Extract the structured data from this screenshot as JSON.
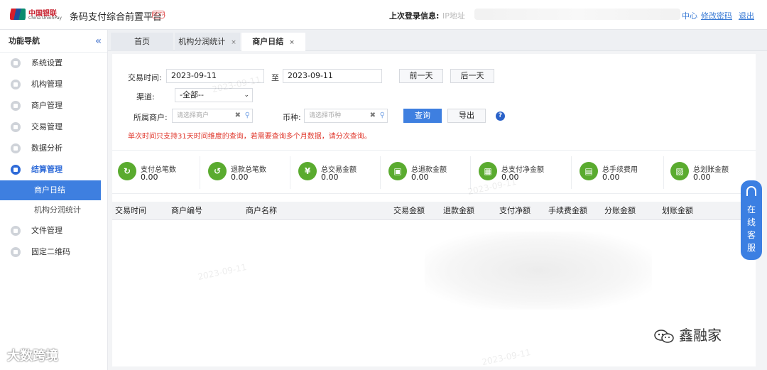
{
  "header": {
    "logo_cn": "中国银联",
    "logo_en": "China UnionPay",
    "app_title": "条码支付综合前置平台",
    "app_badge": "BETA",
    "login_info_label": "上次登录信息:",
    "login_ip_label": "IP地址",
    "personal_center": "中心",
    "change_password": "修改密码",
    "logout": "退出"
  },
  "sidebar": {
    "title": "功能导航",
    "collapse_icon": "«",
    "items": [
      {
        "label": "系统设置"
      },
      {
        "label": "机构管理"
      },
      {
        "label": "商户管理"
      },
      {
        "label": "交易管理"
      },
      {
        "label": "数据分析"
      },
      {
        "label": "结算管理"
      },
      {
        "label": "文件管理"
      },
      {
        "label": "固定二维码"
      }
    ],
    "sub_items": [
      {
        "label": "商户日结"
      },
      {
        "label": "机构分润统计"
      }
    ]
  },
  "tabs": [
    {
      "label": "首页"
    },
    {
      "label": "机构分润统计",
      "close": "×"
    },
    {
      "label": "商户日结",
      "close": "×"
    }
  ],
  "filters": {
    "date_label": "交易时间:",
    "date_from": "2023-09-11",
    "date_sep": "至",
    "date_to": "2023-09-11",
    "prev_day": "前一天",
    "next_day": "后一天",
    "channel_label": "渠道:",
    "channel_value": "-全部--",
    "merchant_label": "所属商户:",
    "merchant_placeholder": "请选择商户",
    "currency_label": "币种:",
    "currency_placeholder": "请选择币种",
    "query": "查询",
    "export": "导出",
    "help": "?"
  },
  "notice": "单次时间只支持31天时间维度的查询，若需要查询多个月数据，请分次查询。",
  "stats": [
    {
      "label": "支付总笔数",
      "value": "0.00",
      "icon": "payment-count-icon"
    },
    {
      "label": "退款总笔数",
      "value": "0.00",
      "icon": "refund-count-icon"
    },
    {
      "label": "总交易金额",
      "value": "0.00",
      "icon": "trade-amount-icon"
    },
    {
      "label": "总退款金额",
      "value": "0.00",
      "icon": "refund-amount-icon"
    },
    {
      "label": "总支付净金额",
      "value": "0.00",
      "icon": "net-amount-icon"
    },
    {
      "label": "总手续费用",
      "value": "0.00",
      "icon": "fee-icon"
    },
    {
      "label": "总划账金额",
      "value": "0.00",
      "icon": "transfer-icon"
    }
  ],
  "table": {
    "columns": [
      "交易时间",
      "商户编号",
      "商户名称",
      "交易金额",
      "退款金额",
      "支付净额",
      "手续费金额",
      "分账金额",
      "划账金额"
    ]
  },
  "chat": {
    "label": "在线客服"
  },
  "watermark": {
    "brand": "鑫融家",
    "corner": "大数跨境",
    "date": "2023-09-11"
  },
  "colors": {
    "accent": "#3e7fe0",
    "stat_icon": "#5aab2f",
    "notice": "#e0382d"
  }
}
